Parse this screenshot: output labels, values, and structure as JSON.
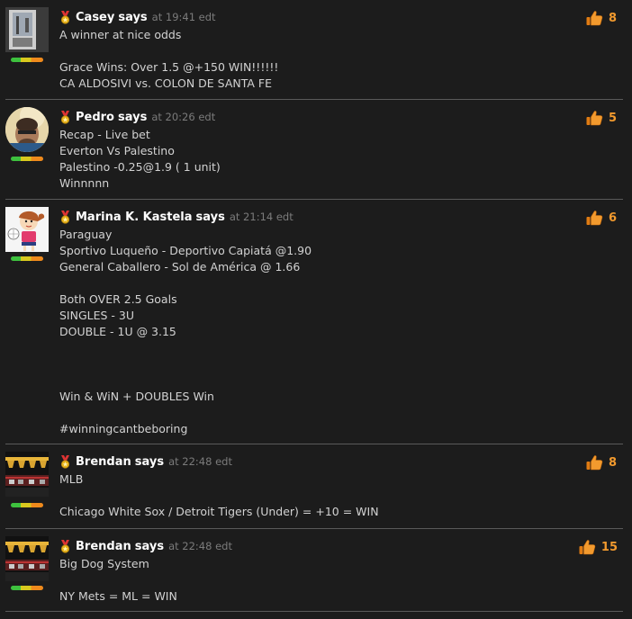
{
  "comments": [
    {
      "author": "Casey",
      "says": "says",
      "meta": "at 19:41 edt",
      "votes": "8",
      "avatar": "photo-avatar",
      "lines": [
        "A winner at nice odds",
        "",
        "Grace Wins: Over 1.5 @+150 WIN!!!!!!",
        "CA ALDOSIVI vs. COLON DE SANTA FE"
      ]
    },
    {
      "author": "Pedro",
      "says": "says",
      "meta": "at 20:26 edt",
      "votes": "5",
      "avatar": "man-avatar",
      "lines": [
        "Recap - Live bet",
        "Everton Vs Palestino",
        "Palestino -0.25@1.9 ( 1 unit)",
        "Winnnnn"
      ]
    },
    {
      "author": "Marina K. Kastela",
      "says": "says",
      "meta": "at 21:14 edt",
      "votes": "6",
      "avatar": "cartoon-girl-avatar",
      "lines": [
        "Paraguay",
        "Sportivo Luqueño - Deportivo Capiatá @1.90",
        "General Caballero - Sol de América @ 1.66",
        "",
        "Both OVER 2.5 Goals",
        "SINGLES - 3U",
        "DOUBLE - 1U @ 3.15",
        "",
        "",
        "",
        "Win & WiN + DOUBLES Win",
        "",
        "#winningcantbeboring"
      ]
    },
    {
      "author": "Brendan",
      "says": "says",
      "meta": "at 22:48 edt",
      "votes": "8",
      "avatar": "stadium-avatar",
      "lines": [
        "MLB",
        "",
        "Chicago White Sox / Detroit Tigers (Under) = +10 = WIN"
      ]
    },
    {
      "author": "Brendan",
      "says": "says",
      "meta": "at 22:48 edt",
      "votes": "15",
      "avatar": "stadium-avatar",
      "lines": [
        "Big Dog System",
        "",
        "NY Mets = ML = WIN"
      ]
    }
  ],
  "colors": {
    "background": "#1c1c1c",
    "text": "#d2d2d2",
    "author": "#ffffff",
    "meta": "#7b7b7b",
    "votes": "#f29a2e"
  },
  "icons": {
    "badge": "medal-icon",
    "vote": "thumbs-up-icon"
  }
}
